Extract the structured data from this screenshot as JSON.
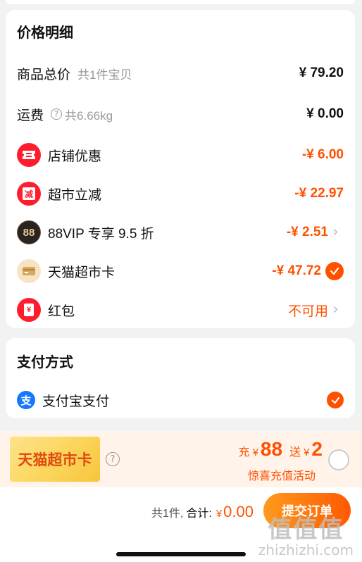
{
  "price_section": {
    "title": "价格明细",
    "goods_total": {
      "label": "商品总价",
      "sub": "共1件宝贝",
      "amount": "¥ 79.20"
    },
    "shipping": {
      "label": "运费",
      "sub": "共6.66kg",
      "amount": "¥ 0.00"
    },
    "shop_discount": {
      "label": "店铺优惠",
      "amount": "-¥ 6.00",
      "icon": "ticket-icon"
    },
    "market_discount": {
      "label": "超市立减",
      "amount": "-¥ 22.97",
      "icon_text": "减"
    },
    "vip": {
      "badge": "88",
      "label": "88VIP 专享 9.5 折",
      "amount": "-¥ 2.51"
    },
    "tmall_card": {
      "label": "天猫超市卡",
      "amount": "-¥ 47.72",
      "checked": true
    },
    "red_packet": {
      "label": "红包",
      "icon_text": "¥",
      "status": "不可用"
    }
  },
  "payment_section": {
    "title": "支付方式",
    "method_icon": "支",
    "method": "支付宝支付",
    "checked": true
  },
  "promo": {
    "card_name": "天猫超市卡",
    "charge_word": "充",
    "charge_yen": "¥",
    "charge_amount": "88",
    "gift_word": "送",
    "gift_yen": "¥",
    "gift_amount": "2",
    "note": "惊喜充值活动"
  },
  "bottom_bar": {
    "count": "共1件,",
    "total_label": "合计:",
    "total_yen": "¥",
    "total_amount": "0.00",
    "submit": "提交订单"
  },
  "watermark": {
    "cn": "值值值",
    "en": "zhizhizhi.com"
  },
  "colors": {
    "accent": "#ff5000",
    "alipay": "#1677ff",
    "red_icon": "#ff1d2d"
  }
}
